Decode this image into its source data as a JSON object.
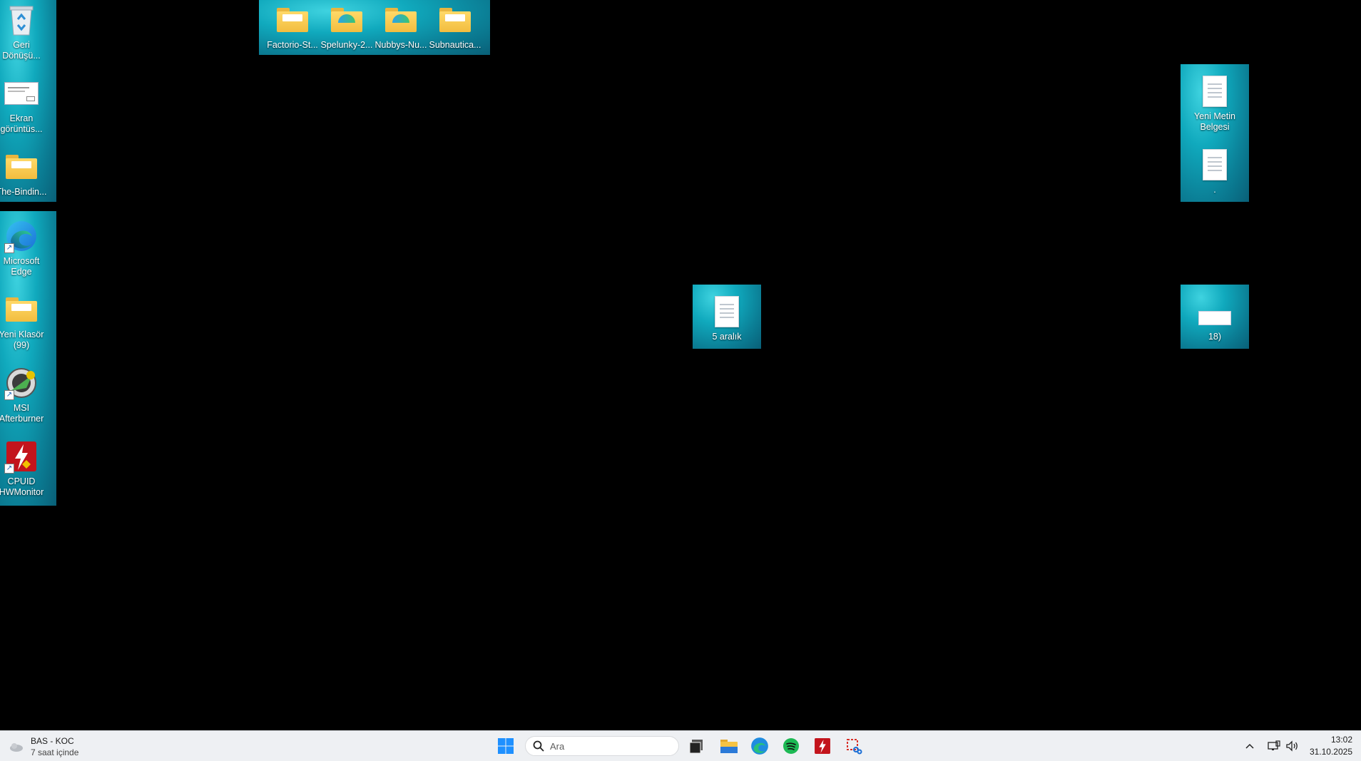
{
  "desktop": {
    "left_column_top": [
      {
        "label": "Geri Dönüşü...",
        "icon": "recycle-bin-icon"
      },
      {
        "label": "Ekran görüntüs...",
        "icon": "screenshot-file-icon"
      },
      {
        "label": "The-Bindin...",
        "icon": "folder-icon"
      }
    ],
    "left_column_bottom": [
      {
        "label": "Microsoft Edge",
        "icon": "edge-icon"
      },
      {
        "label": "Yeni Klasör (99)",
        "icon": "folder-icon"
      },
      {
        "label": "MSI Afterburner",
        "icon": "msi-afterburner-icon"
      },
      {
        "label": "CPUID HWMonitor",
        "icon": "hwmonitor-icon"
      }
    ],
    "top_row": [
      {
        "label": "Factorio-St...",
        "icon": "folder-icon"
      },
      {
        "label": "Spelunky-2...",
        "icon": "folder-icon"
      },
      {
        "label": "Nubbys-Nu...",
        "icon": "folder-icon"
      },
      {
        "label": "Subnautica...",
        "icon": "folder-icon"
      }
    ],
    "right_column": [
      {
        "label": "Yeni Metin Belgesi",
        "icon": "text-document-icon"
      },
      {
        "label": ".",
        "icon": "text-document-icon"
      }
    ],
    "middle_file": {
      "label": "5 aralık",
      "icon": "text-document-icon"
    },
    "right_bottom_file": {
      "label": "18)",
      "icon": "image-file-icon"
    }
  },
  "taskbar": {
    "weather": {
      "title": "BAS - KOC",
      "subtitle": "7 saat içinde",
      "icon": "weather-icon"
    },
    "search_placeholder": "Ara",
    "apps": [
      "start-icon",
      "task-view-icon",
      "file-explorer-icon",
      "edge-icon",
      "spotify-icon",
      "hwmonitor-icon",
      "snipping-tool-icon"
    ],
    "tray": {
      "time": "13:02",
      "date": "31.10.2025"
    }
  }
}
